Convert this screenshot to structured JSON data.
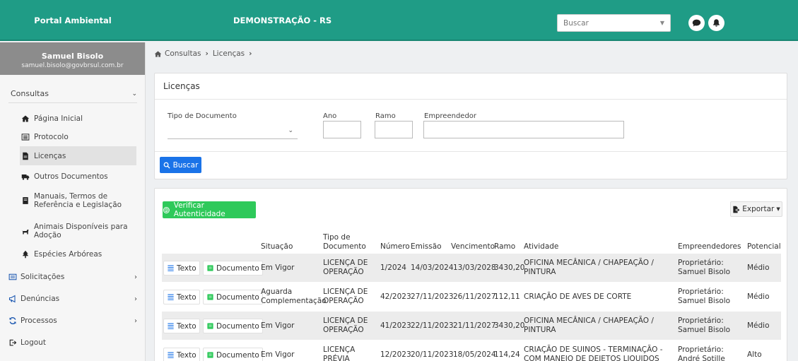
{
  "app": {
    "brand": "Portal Ambiental",
    "title": "DEMONSTRAÇÃO - RS",
    "search_placeholder": "Buscar",
    "accent_color": "#1f9c86"
  },
  "user": {
    "name": "Samuel Bisolo",
    "email": "samuel.bisolo@govbrsul.com.br"
  },
  "sidebar": {
    "group": "Consultas",
    "subitems": [
      {
        "label": "Página Inicial",
        "icon": "home-icon"
      },
      {
        "label": "Protocolo",
        "icon": "list-icon"
      },
      {
        "label": "Licenças",
        "icon": "file-icon"
      },
      {
        "label": "Outros Documentos",
        "icon": "truck-icon"
      },
      {
        "label": "Manuais, Termos de Referência e Legislação",
        "icon": "book-icon"
      },
      {
        "label": "Animais Disponíveis para Adoção",
        "icon": "dog-icon"
      },
      {
        "label": "Espécies Arbóreas",
        "icon": "tree-icon"
      }
    ],
    "items": [
      {
        "label": "Solicitações",
        "icon": "form-icon"
      },
      {
        "label": "Denúncias",
        "icon": "megaphone-icon"
      },
      {
        "label": "Processos",
        "icon": "refresh-icon"
      },
      {
        "label": "Logout",
        "icon": "logout-icon"
      }
    ]
  },
  "breadcrumb": {
    "part1": "Consultas",
    "part2": "Licenças"
  },
  "filters": {
    "panel_title": "Licenças",
    "tipo_label": "Tipo de Documento",
    "ano_label": "Ano",
    "ramo_label": "Ramo",
    "empreendedor_label": "Empreendedor",
    "search_button": "Buscar"
  },
  "results": {
    "verify_button": "Verificar Autenticidade",
    "export_button": "Exportar",
    "headers": {
      "situacao": "Situação",
      "tipo": "Tipo de Documento",
      "numero": "Número",
      "emissao": "Emissão",
      "vencimento": "Vencimento",
      "ramo": "Ramo",
      "atividade": "Atividade",
      "empreendedores": "Empreendedores",
      "potencial": "Potencial"
    },
    "texto_label": "Texto",
    "documento_label": "Documento",
    "rows": [
      {
        "situacao": "Em Vigor",
        "tipo": "LICENÇA DE OPERAÇÃO",
        "numero": "1/2024",
        "emissao": "14/03/2024",
        "vencimento": "13/03/2028",
        "ramo": "3430,20",
        "atividade": "OFICINA MECÂNICA / CHAPEAÇÃO / PINTURA",
        "empreendedor": "Proprietário: Samuel Bisolo",
        "potencial": "Médio"
      },
      {
        "situacao": "Aguarda Complementação",
        "tipo": "LICENÇA DE OPERAÇÃO",
        "numero": "42/2023",
        "emissao": "27/11/2023",
        "vencimento": "26/11/2027",
        "ramo": "112,11",
        "atividade": "CRIAÇÃO DE AVES DE CORTE",
        "empreendedor": "Proprietário: Samuel Bisolo",
        "potencial": "Médio"
      },
      {
        "situacao": "Em Vigor",
        "tipo": "LICENÇA DE OPERAÇÃO",
        "numero": "41/2023",
        "emissao": "22/11/2023",
        "vencimento": "21/11/2027",
        "ramo": "3430,20",
        "atividade": "OFICINA MECÂNICA / CHAPEAÇÃO / PINTURA",
        "empreendedor": "Proprietário: Samuel Bisolo",
        "potencial": "Médio"
      },
      {
        "situacao": "Em Vigor",
        "tipo": "LICENÇA PRÉVIA",
        "numero": "12/2023",
        "emissao": "20/11/2023",
        "vencimento": "18/05/2024",
        "ramo": "114,24",
        "atividade": "CRIAÇÃO DE SUINOS - TERMINAÇÃO - COM MANEJO DE DEJETOS LIQUIDOS",
        "empreendedor": "Proprietário: André Sotille",
        "potencial": "Alto"
      }
    ]
  }
}
